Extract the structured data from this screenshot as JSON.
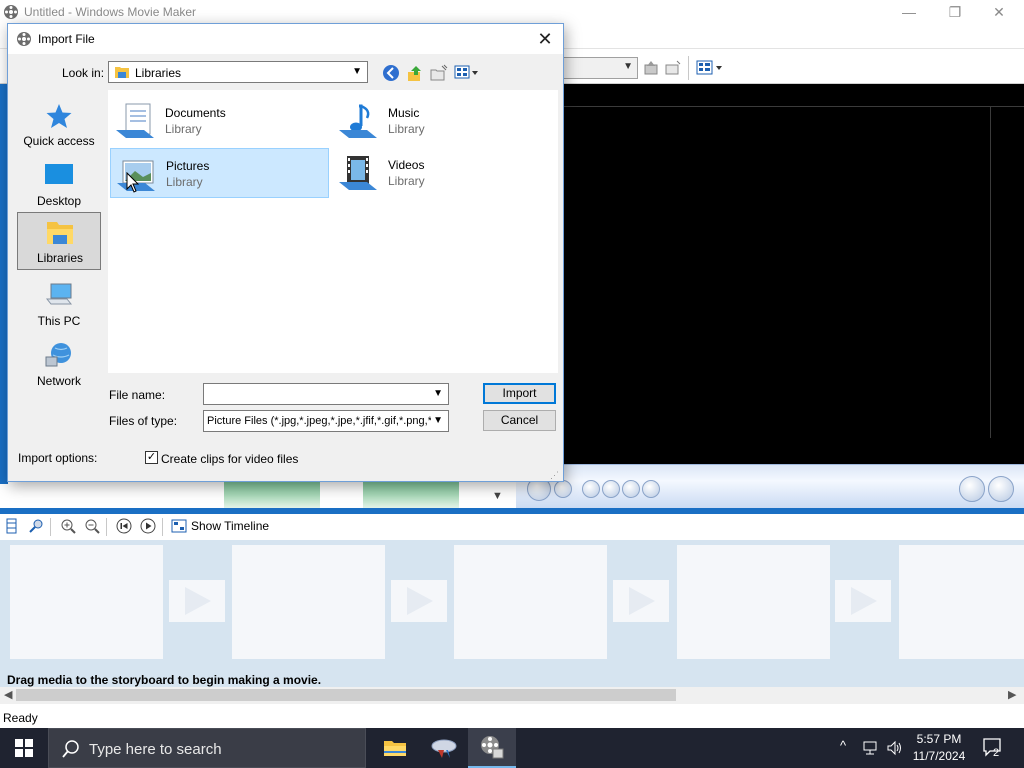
{
  "main_window": {
    "title": "Untitled - Windows Movie Maker",
    "minimize_glyph": "—",
    "restore_glyph": "❐",
    "close_glyph": "✕"
  },
  "storyboard": {
    "show_timeline_label": "Show Timeline",
    "hint": "Drag media to the storyboard to begin making a movie."
  },
  "status": {
    "text": "Ready"
  },
  "import_dialog": {
    "title": "Import File",
    "look_in_label": "Look in:",
    "look_in_value": "Libraries",
    "places": [
      {
        "label": "Quick access"
      },
      {
        "label": "Desktop"
      },
      {
        "label": "Libraries"
      },
      {
        "label": "This PC"
      },
      {
        "label": "Network"
      }
    ],
    "selected_place": "Libraries",
    "items": [
      {
        "name": "Documents",
        "subtitle": "Library"
      },
      {
        "name": "Music",
        "subtitle": "Library"
      },
      {
        "name": "Pictures",
        "subtitle": "Library"
      },
      {
        "name": "Videos",
        "subtitle": "Library"
      }
    ],
    "selected_item": "Pictures",
    "file_name_label": "File name:",
    "file_name_value": "",
    "files_of_type_label": "Files of type:",
    "files_of_type_value": "Picture Files (*.jpg,*.jpeg,*.jpe,*.jfif,*.gif,*.png,*.b",
    "import_button": "Import",
    "cancel_button": "Cancel",
    "import_options_label": "Import options:",
    "create_clips_label": "Create clips for video files",
    "create_clips_checked": true
  },
  "taskbar": {
    "search_placeholder": "Type here to search",
    "time": "5:57 PM",
    "date": "11/7/2024",
    "notification_count": "2"
  },
  "colors": {
    "accent_blue": "#1a6fc4",
    "selection": "#cce8ff",
    "taskbar": "#1f2330"
  }
}
